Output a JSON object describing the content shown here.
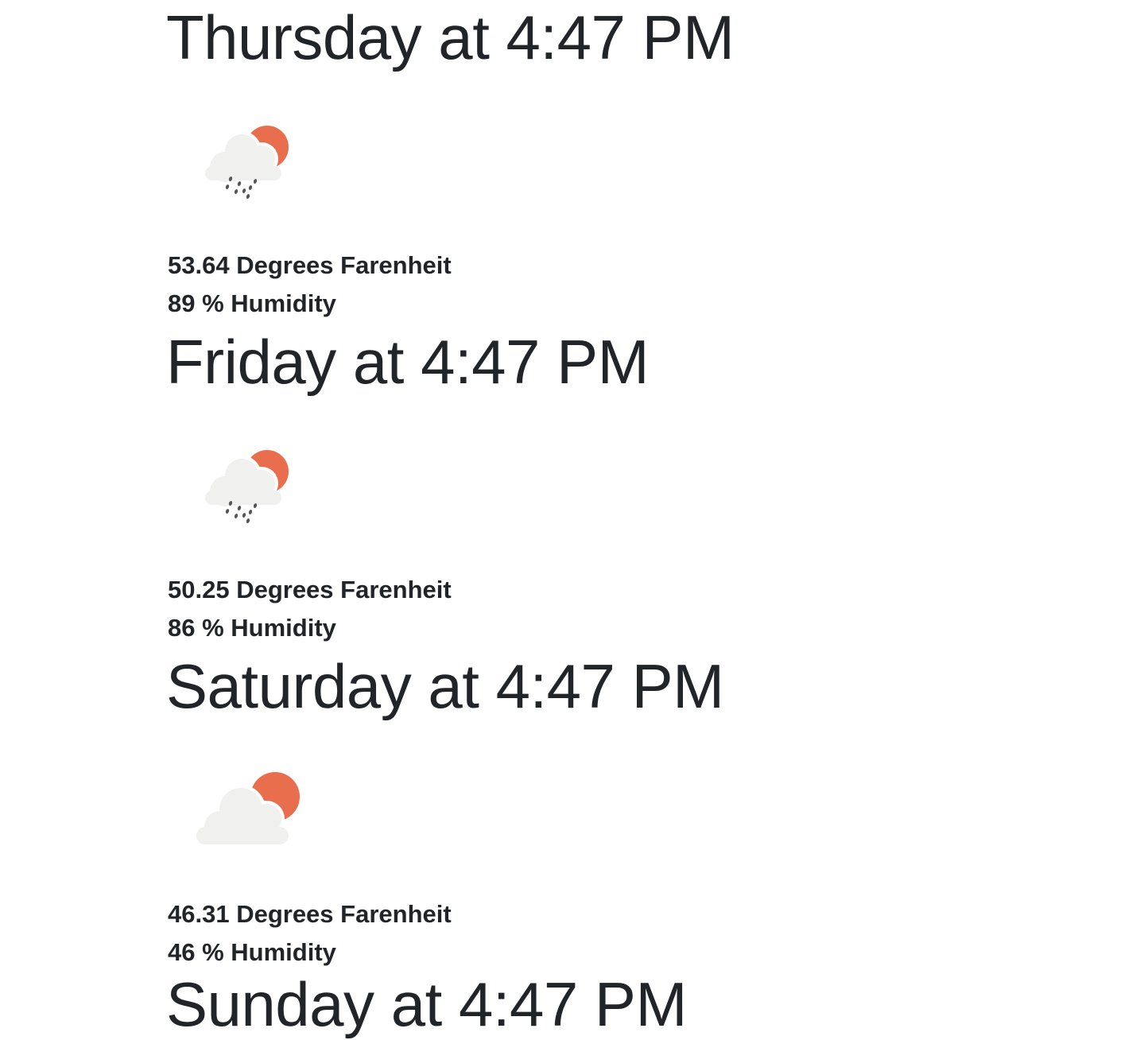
{
  "forecast": [
    {
      "day_label": "Thursday at 4:47 PM",
      "icon": "rain-cloud-sun-icon",
      "temperature": "53.64 Degrees Farenheit",
      "humidity": "89 % Humidity"
    },
    {
      "day_label": "Friday at 4:47 PM",
      "icon": "rain-cloud-sun-icon",
      "temperature": "50.25 Degrees Farenheit",
      "humidity": "86 % Humidity"
    },
    {
      "day_label": "Saturday at 4:47 PM",
      "icon": "cloud-sun-icon",
      "temperature": "46.31 Degrees Farenheit",
      "humidity": "46 % Humidity"
    },
    {
      "day_label": "Sunday at 4:47 PM"
    }
  ],
  "colors": {
    "text": "#212529",
    "sun": "#e96e4e",
    "cloud": "#f0f0ef",
    "rain": "#555555"
  }
}
